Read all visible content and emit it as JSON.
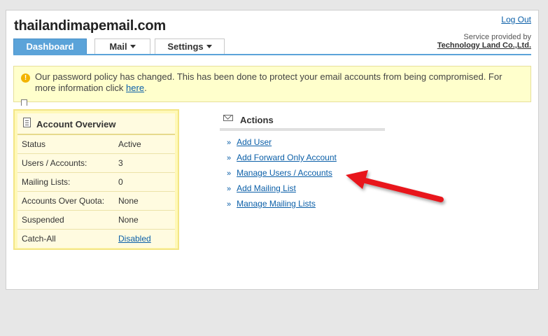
{
  "header": {
    "brand": "thailandimapemail.com",
    "logout_label": "Log Out",
    "service_prefix": "Service provided by",
    "service_company": "Technology Land Co.,Ltd."
  },
  "tabs": [
    {
      "label": "Dashboard",
      "active": true
    },
    {
      "label": "Mail",
      "active": false
    },
    {
      "label": "Settings",
      "active": false
    }
  ],
  "notice": {
    "text": "Our password policy has changed. This has been done to protect your email accounts from being compromised. For more information click ",
    "link": "here",
    "suffix": "."
  },
  "overview": {
    "title": "Account Overview",
    "rows": [
      {
        "key": "Status",
        "value": "Active"
      },
      {
        "key": "Users / Accounts:",
        "value": "3"
      },
      {
        "key": "Mailing Lists:",
        "value": "0"
      },
      {
        "key": "Accounts Over Quota:",
        "value": "None"
      },
      {
        "key": "Suspended",
        "value": "None"
      },
      {
        "key": "Catch-All",
        "value": "Disabled"
      }
    ]
  },
  "actions": {
    "title": "Actions",
    "bullet": "»",
    "items": [
      "Add User",
      "Add Forward Only Account",
      "Manage Users / Accounts",
      "Add Mailing List",
      "Manage Mailing Lists"
    ]
  },
  "colors": {
    "tab_active": "#5ba3d9",
    "notice_bg": "#ffffcc",
    "overview_bg": "#fff8b8",
    "link": "#0b5fa8",
    "arrow": "#e8141c"
  }
}
